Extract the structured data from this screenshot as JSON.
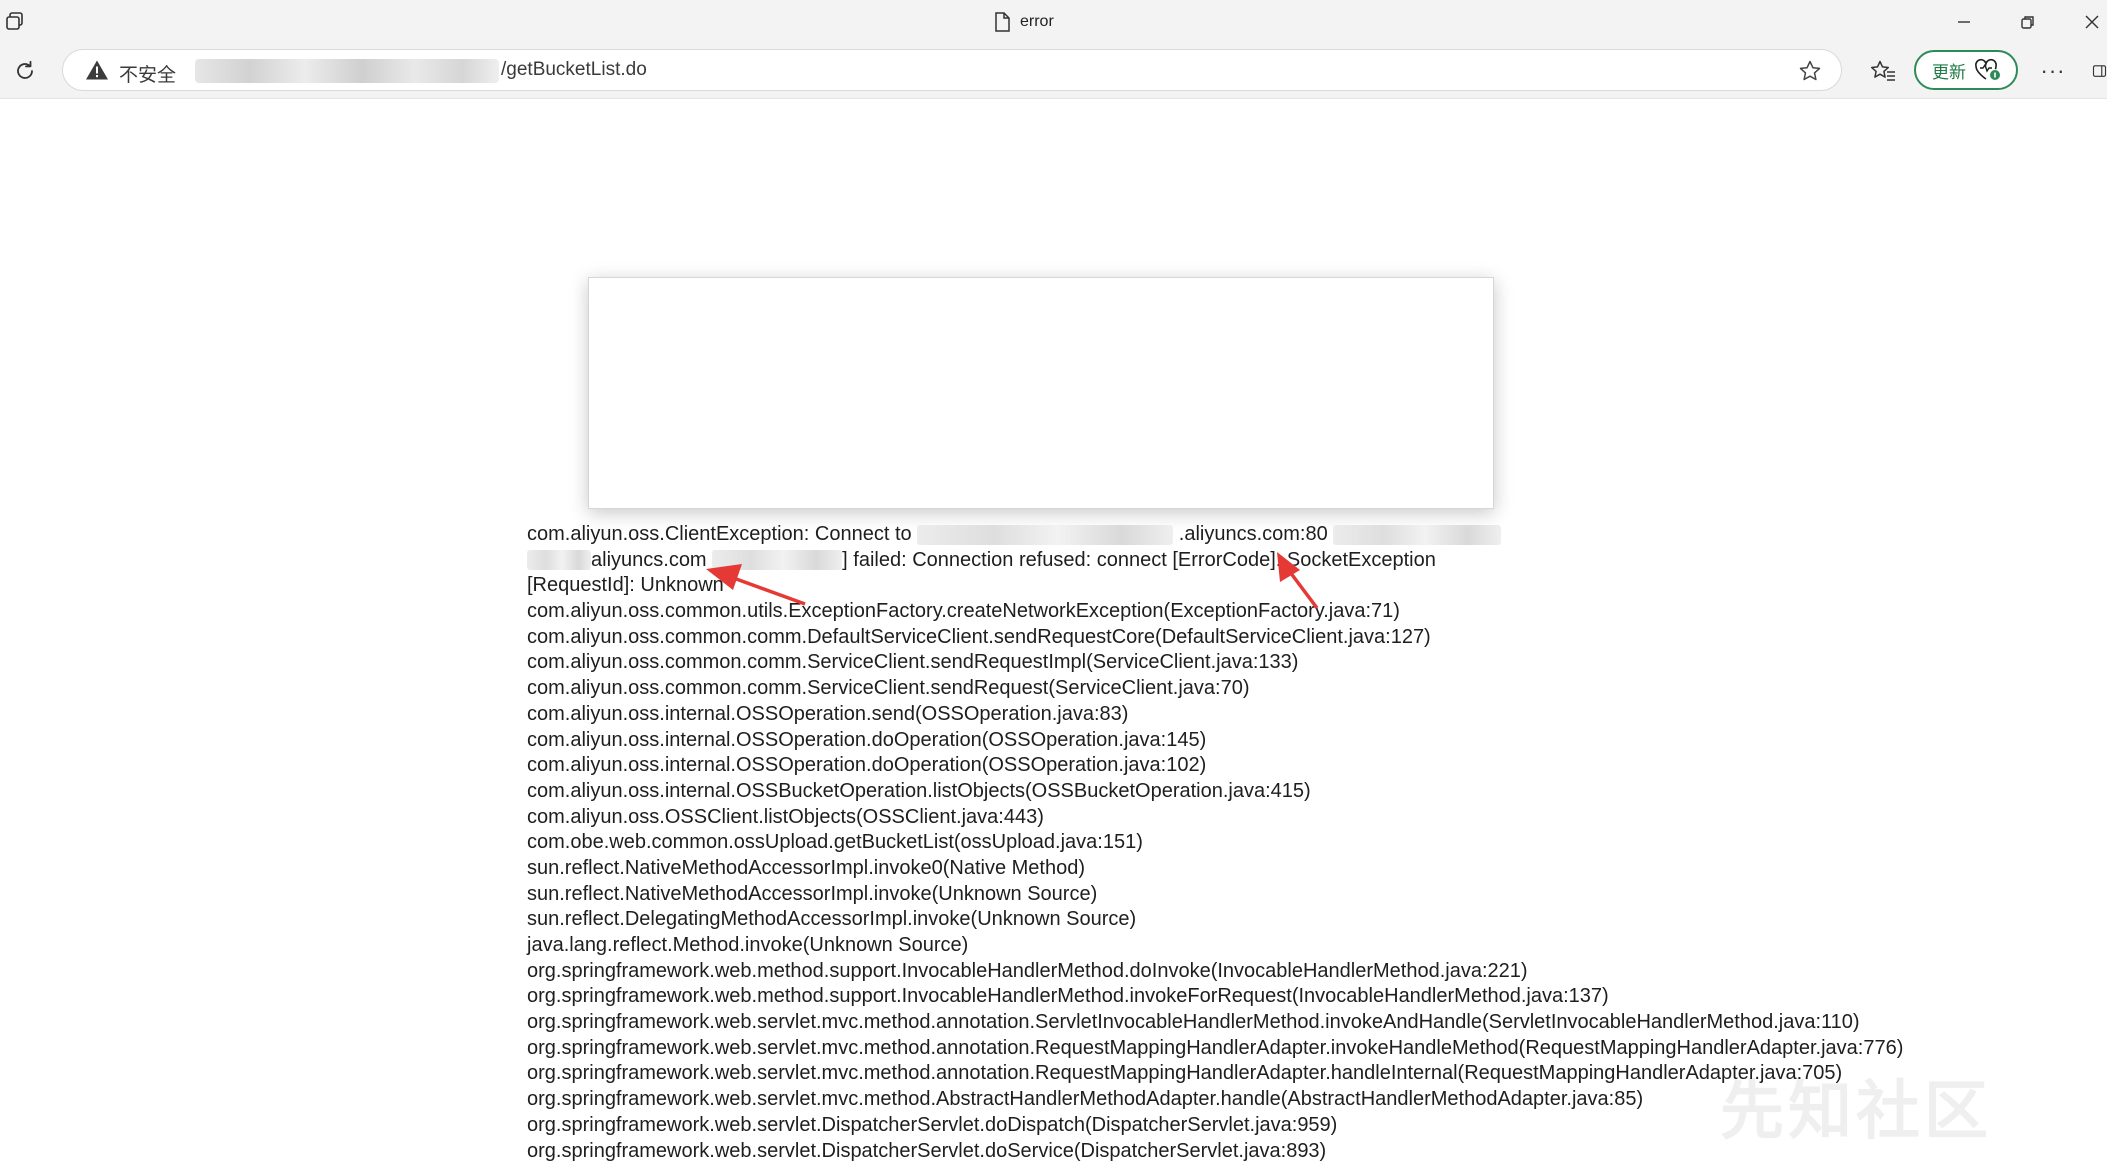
{
  "browser": {
    "tab_title": "error",
    "security_label": "不安全",
    "url_path": "/getBucketList.do",
    "update_label": "更新",
    "more_label": "···"
  },
  "stack_trace": {
    "line1_prefix": "com.aliyun.oss.ClientException: Connect to",
    "line1_host_suffix": ".aliyuncs.com:80",
    "line2_host_suffix": "aliyuncs.com",
    "line2_rest": "] failed: Connection refused: connect [ErrorCode]: SocketException",
    "line3": "[RequestId]: Unknown",
    "frames": [
      "com.aliyun.oss.common.utils.ExceptionFactory.createNetworkException(ExceptionFactory.java:71)",
      "com.aliyun.oss.common.comm.DefaultServiceClient.sendRequestCore(DefaultServiceClient.java:127)",
      "com.aliyun.oss.common.comm.ServiceClient.sendRequestImpl(ServiceClient.java:133)",
      "com.aliyun.oss.common.comm.ServiceClient.sendRequest(ServiceClient.java:70)",
      "com.aliyun.oss.internal.OSSOperation.send(OSSOperation.java:83)",
      "com.aliyun.oss.internal.OSSOperation.doOperation(OSSOperation.java:145)",
      "com.aliyun.oss.internal.OSSOperation.doOperation(OSSOperation.java:102)",
      "com.aliyun.oss.internal.OSSBucketOperation.listObjects(OSSBucketOperation.java:415)",
      "com.aliyun.oss.OSSClient.listObjects(OSSClient.java:443)",
      "com.obe.web.common.ossUpload.getBucketList(ossUpload.java:151)",
      "sun.reflect.NativeMethodAccessorImpl.invoke0(Native Method)",
      "sun.reflect.NativeMethodAccessorImpl.invoke(Unknown Source)",
      "sun.reflect.DelegatingMethodAccessorImpl.invoke(Unknown Source)",
      "java.lang.reflect.Method.invoke(Unknown Source)",
      "org.springframework.web.method.support.InvocableHandlerMethod.doInvoke(InvocableHandlerMethod.java:221)",
      "org.springframework.web.method.support.InvocableHandlerMethod.invokeForRequest(InvocableHandlerMethod.java:137)",
      "org.springframework.web.servlet.mvc.method.annotation.ServletInvocableHandlerMethod.invokeAndHandle(ServletInvocableHandlerMethod.java:110)",
      "org.springframework.web.servlet.mvc.method.annotation.RequestMappingHandlerAdapter.invokeHandleMethod(RequestMappingHandlerAdapter.java:776)",
      "org.springframework.web.servlet.mvc.method.annotation.RequestMappingHandlerAdapter.handleInternal(RequestMappingHandlerAdapter.java:705)",
      "org.springframework.web.servlet.mvc.method.AbstractHandlerMethodAdapter.handle(AbstractHandlerMethodAdapter.java:85)",
      "org.springframework.web.servlet.DispatcherServlet.doDispatch(DispatcherServlet.java:959)",
      "org.springframework.web.servlet.DispatcherServlet.doService(DispatcherServlet.java:893)"
    ]
  },
  "watermark": "先知社区",
  "colors": {
    "annotation_arrow": "#e53935",
    "update_accent": "#2e8b57",
    "chrome_bg": "#f3f3f3"
  },
  "icons": {
    "workspace": "workspaces-icon",
    "tab": "document-icon",
    "refresh": "refresh-icon",
    "warning": "warning-triangle-icon",
    "star": "star-icon",
    "favorites": "favorites-icon",
    "update": "heart-update-icon"
  }
}
